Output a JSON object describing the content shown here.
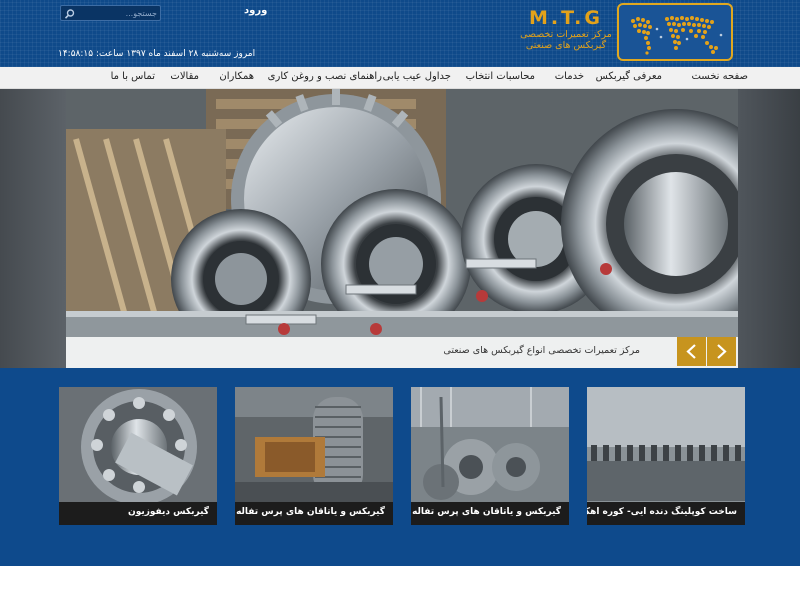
{
  "header": {
    "brand_mark": "M.T.G",
    "brand_line1": "مرکز تعمیرات تخصصی",
    "brand_line2": "گیربکس های صنعتی",
    "search_placeholder": "جستجو...",
    "login_label": "ورود",
    "datetime": "امروز سه‌شنبه ۲۸ اسفند ماه ۱۳۹۷ ساعت: ۱۴:۵۸:۱۵"
  },
  "nav": {
    "items": [
      {
        "label": "صفحه نخست"
      },
      {
        "label": "معرفی گیربکس"
      },
      {
        "label": "خدمات"
      },
      {
        "label": "محاسبات انتخاب"
      },
      {
        "label": "جداول عیب یابی"
      },
      {
        "label": "راهنمای نصب و روغن کاری"
      },
      {
        "label": "همکاران"
      },
      {
        "label": "مقالات"
      },
      {
        "label": "تماس با ما"
      }
    ]
  },
  "hero": {
    "caption": "مرکز تعمیرات تخصصی انواع گیربکس های صنعتی"
  },
  "cards": [
    {
      "label": "ساخت کوپلینگ دنده ایی- کوره اهک"
    },
    {
      "label": "گیربکس و یاتاقان های پرس تفاله"
    },
    {
      "label": "گیربکس و یاتاقان های پرس تفاله"
    },
    {
      "label": "گیربکس دیفوزیون"
    }
  ],
  "colors": {
    "header_blue": "#0f4a8a",
    "accent_gold": "#c7941e",
    "main_blue": "#0e4a8c"
  }
}
